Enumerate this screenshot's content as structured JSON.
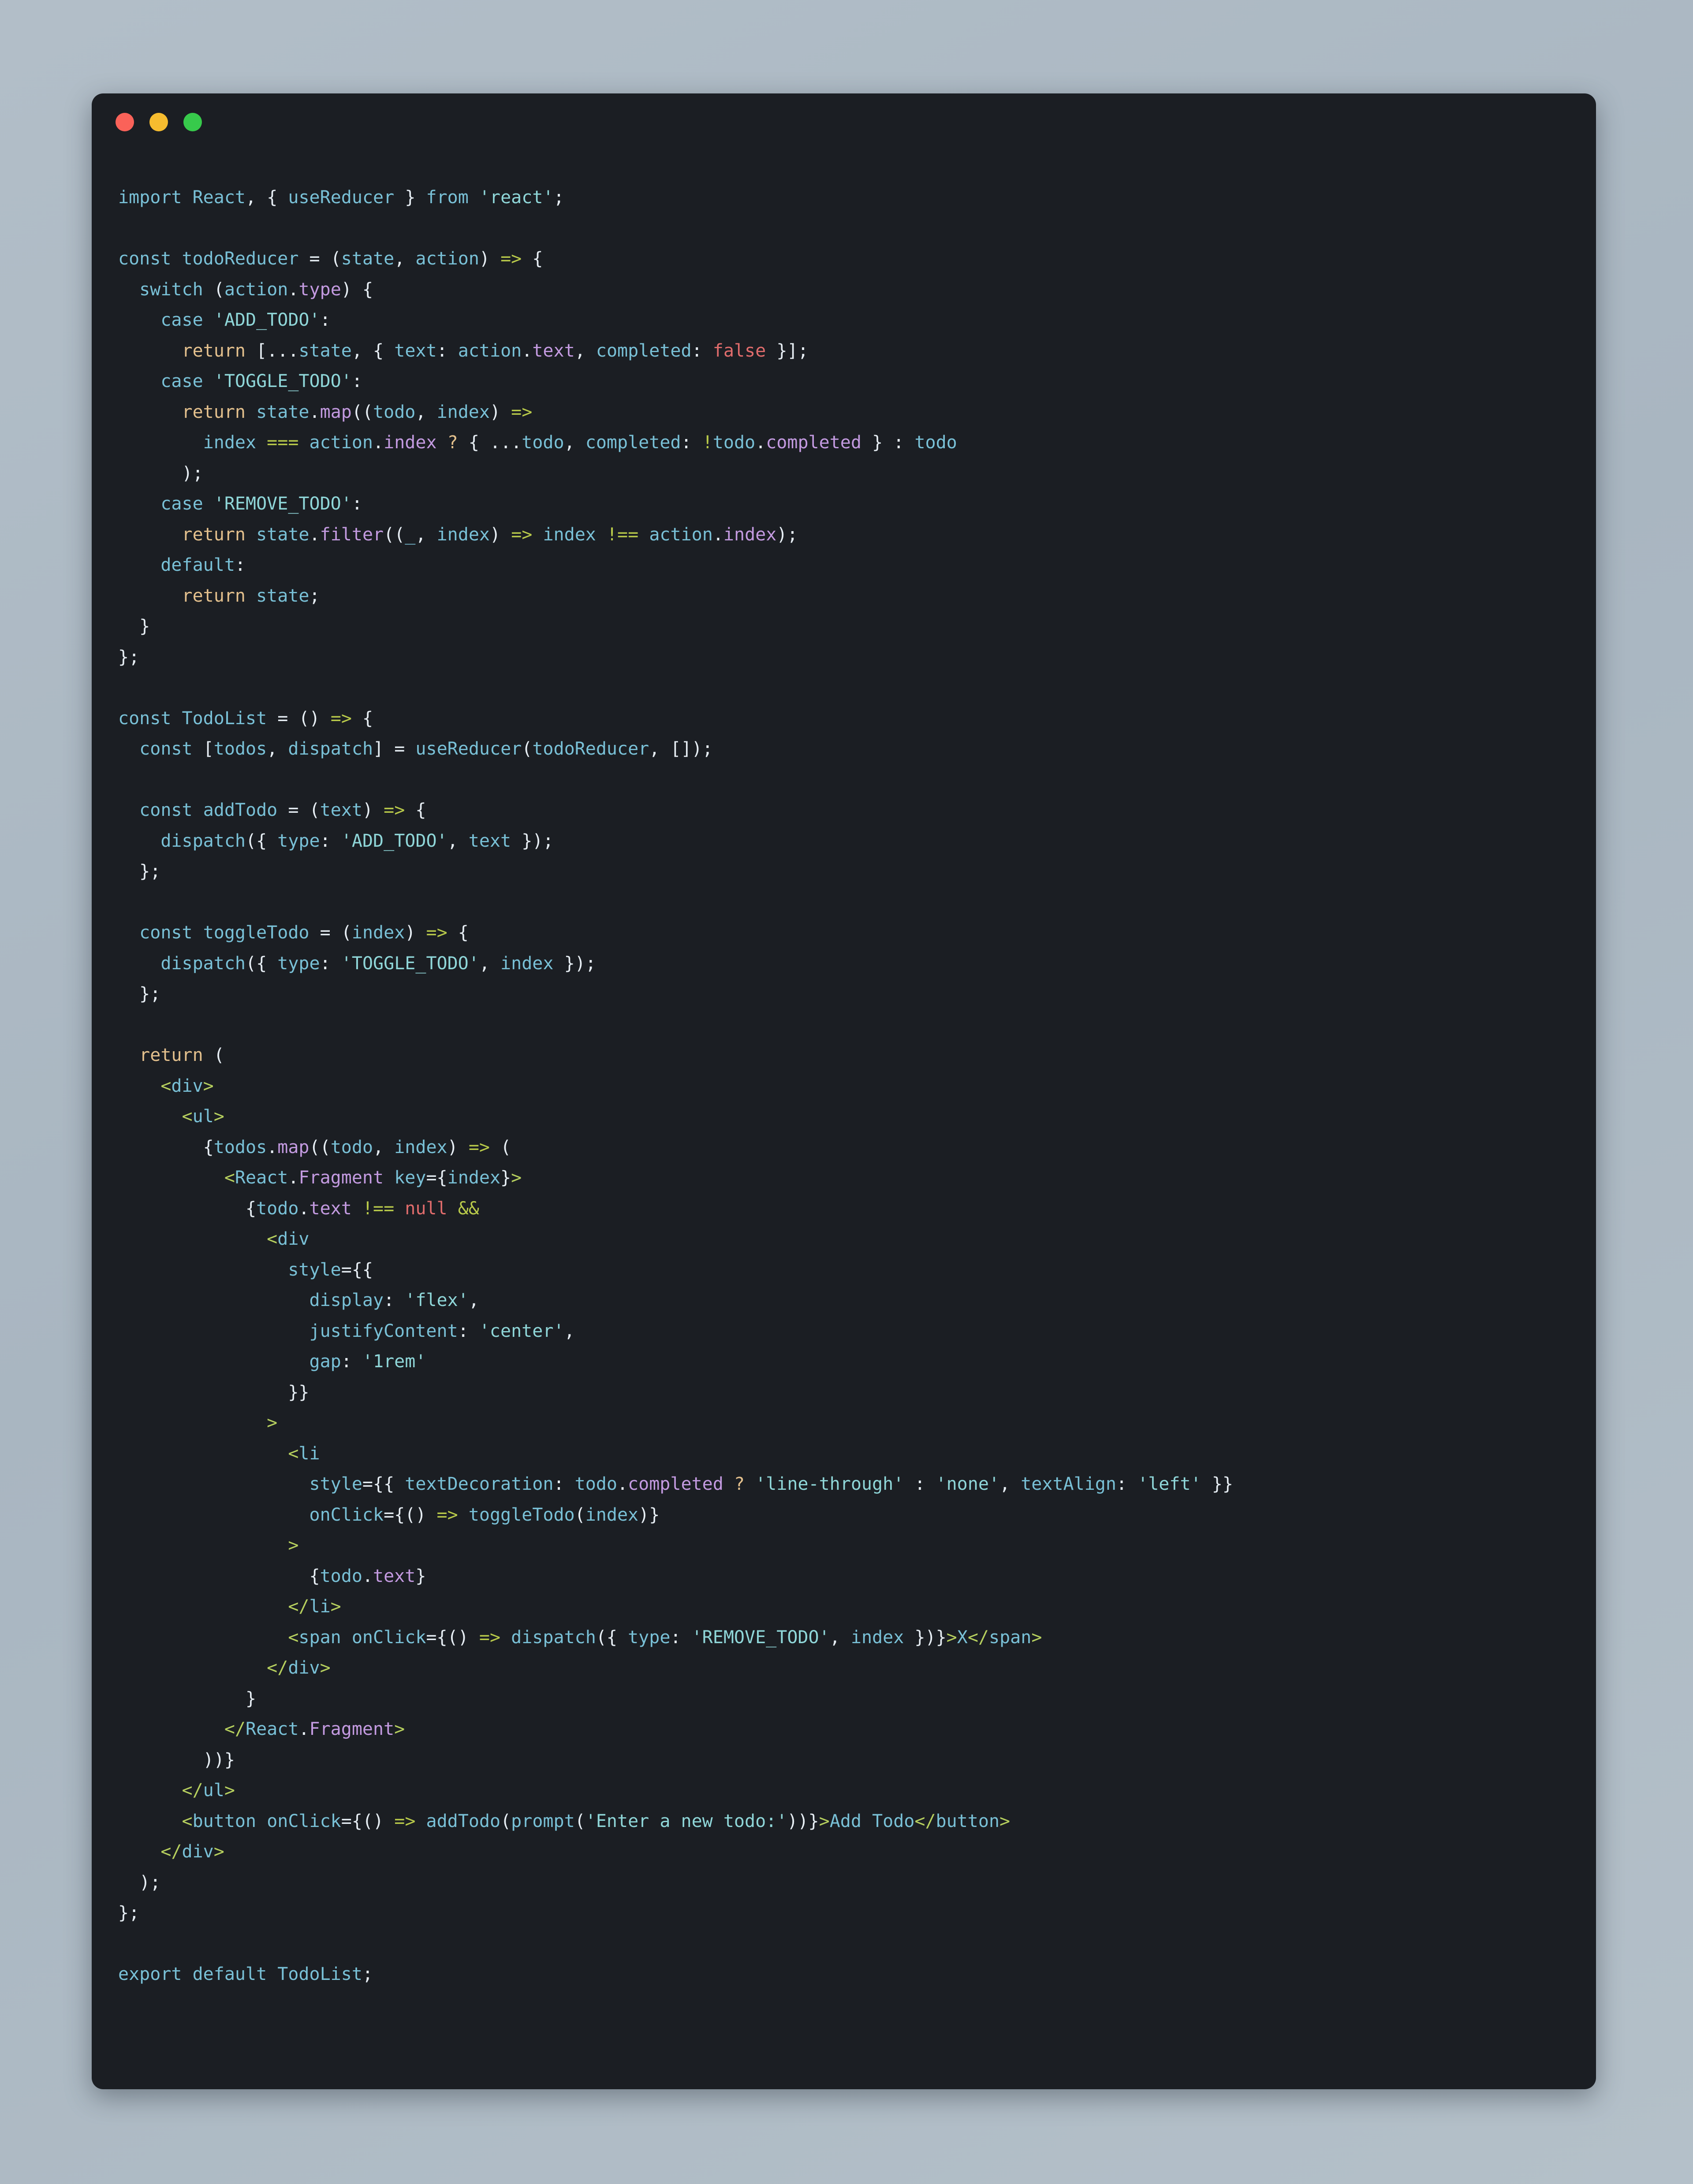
{
  "window": {
    "controls": [
      {
        "name": "close",
        "color": "#fa6259"
      },
      {
        "name": "minimize",
        "color": "#f6bc2f"
      },
      {
        "name": "maximize",
        "color": "#37ca4b"
      }
    ]
  },
  "theme": {
    "page_background": "#aebbc6",
    "panel_background": "#1b1e23",
    "default_text": "#c9d1d9",
    "keyword": "#e3c08d",
    "declaration": "#79c0d6",
    "function": "#c39ae0",
    "string": "#8fd6d8",
    "literal": "#e06c6c",
    "punctuation": "#e6edf3",
    "operator": "#b8c94a",
    "jsx_tag": "#b6cf5e"
  },
  "code": {
    "language": "jsx",
    "filename_symbol": "TodoList",
    "lines": [
      "import React, { useReducer } from 'react';",
      "",
      "const todoReducer = (state, action) => {",
      "  switch (action.type) {",
      "    case 'ADD_TODO':",
      "      return [...state, { text: action.text, completed: false }];",
      "    case 'TOGGLE_TODO':",
      "      return state.map((todo, index) =>",
      "        index === action.index ? { ...todo, completed: !todo.completed } : todo",
      "      );",
      "    case 'REMOVE_TODO':",
      "      return state.filter((_, index) => index !== action.index);",
      "    default:",
      "      return state;",
      "  }",
      "};",
      "",
      "const TodoList = () => {",
      "  const [todos, dispatch] = useReducer(todoReducer, []);",
      "",
      "  const addTodo = (text) => {",
      "    dispatch({ type: 'ADD_TODO', text });",
      "  };",
      "",
      "  const toggleTodo = (index) => {",
      "    dispatch({ type: 'TOGGLE_TODO', index });",
      "  };",
      "",
      "  return (",
      "    <div>",
      "      <ul>",
      "        {todos.map((todo, index) => (",
      "          <React.Fragment key={index}>",
      "            {todo.text !== null &&",
      "              <div",
      "                style={{",
      "                  display: 'flex',",
      "                  justifyContent: 'center',",
      "                  gap: '1rem'",
      "                }}",
      "              >",
      "                <li",
      "                  style={{ textDecoration: todo.completed ? 'line-through' : 'none', textAlign: 'left' }}",
      "                  onClick={() => toggleTodo(index)}",
      "                >",
      "                  {todo.text}",
      "                </li>",
      "                <span onClick={() => dispatch({ type: 'REMOVE_TODO', index })}>X</span>",
      "              </div>",
      "            }",
      "          </React.Fragment>",
      "        ))}",
      "      </ul>",
      "      <button onClick={() => addTodo(prompt('Enter a new todo:'))}>Add Todo</button>",
      "    </div>",
      "  );",
      "};",
      "",
      "export default TodoList;"
    ],
    "strings_used": [
      "'react'",
      "'ADD_TODO'",
      "'TOGGLE_TODO'",
      "'REMOVE_TODO'",
      "'flex'",
      "'center'",
      "'1rem'",
      "'line-through'",
      "'none'",
      "'left'",
      "'Enter a new todo:'"
    ],
    "literals_used": [
      "false",
      "null"
    ],
    "jsx_elements": [
      "div",
      "ul",
      "React.Fragment",
      "li",
      "span",
      "button"
    ],
    "visible_button_text": "Add Todo",
    "visible_remove_text": "X"
  }
}
